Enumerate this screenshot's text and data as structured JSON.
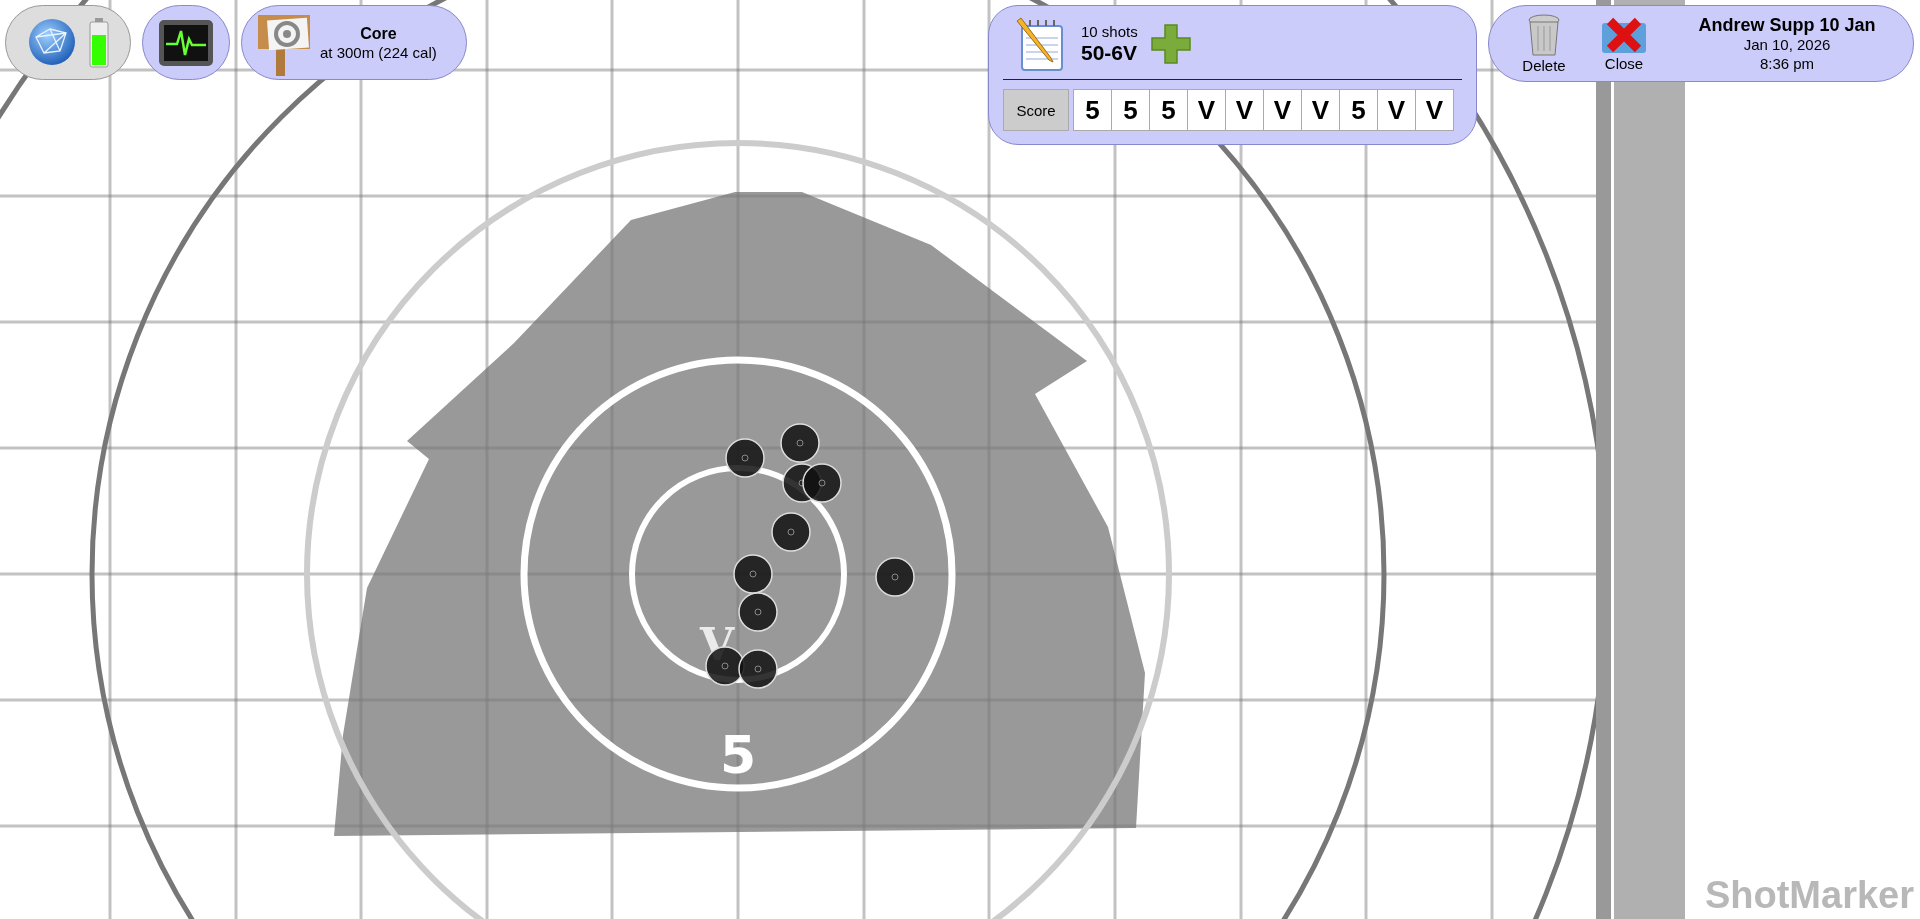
{
  "session": {
    "title": "Core",
    "subtitle": "at 300m (224 cal)"
  },
  "summary": {
    "shot_count": "10 shots",
    "total": "50-6V"
  },
  "score_row": {
    "label": "Score",
    "values": [
      "5",
      "5",
      "5",
      "V",
      "V",
      "V",
      "V",
      "5",
      "V",
      "V"
    ]
  },
  "record": {
    "delete": "Delete",
    "close": "Close",
    "name": "Andrew Supp 10 Jan",
    "date": "Jan 10, 2026",
    "time": "8:36 pm"
  },
  "target": {
    "inner_label": "V",
    "outer_label": "5"
  },
  "brand": "ShotMarker"
}
